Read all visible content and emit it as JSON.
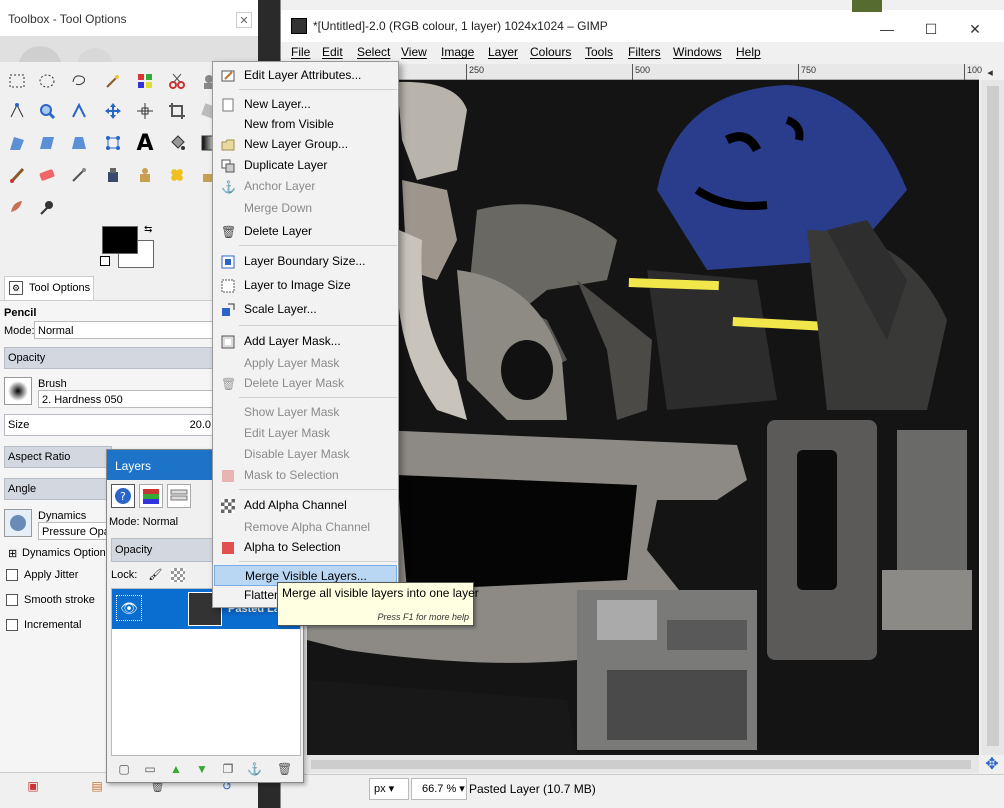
{
  "gimp": {
    "title": "*[Untitled]-2.0 (RGB colour, 1 layer) 1024x1024 – GIMP",
    "menu": [
      "File",
      "Edit",
      "Select",
      "View",
      "Image",
      "Layer",
      "Colours",
      "Tools",
      "Filters",
      "Windows",
      "Help"
    ],
    "ruler_ticks": [
      "250",
      "500",
      "750",
      "100"
    ],
    "minimize_icon": "—",
    "maximize_icon": "☐",
    "close_icon": "✕",
    "status": {
      "unit": "px",
      "zoom": "66.7 %",
      "layer_info": "Pasted Layer (10.7 MB)"
    }
  },
  "toolbox": {
    "title": "Toolbox - Tool Options",
    "tab_label": "Tool Options",
    "tool_name": "Pencil",
    "mode_label": "Mode:",
    "mode_value": "Normal",
    "opacity_label": "Opacity",
    "brush_label": "Brush",
    "brush_value": "2. Hardness 050",
    "size_label": "Size",
    "size_value": "20.0",
    "aspect_label": "Aspect Ratio",
    "angle_label": "Angle",
    "dynamics_label": "Dynamics",
    "dynamics_value": "Pressure Opac",
    "dynamics_options": "Dynamics Options",
    "apply_jitter": "Apply Jitter",
    "smooth_stroke": "Smooth stroke",
    "incremental": "Incremental"
  },
  "layers": {
    "title": "Layers",
    "mode": "Mode: Normal",
    "opacity": "Opacity",
    "lock": "Lock:",
    "layer_name": "Pasted Layer"
  },
  "menu": {
    "items": [
      {
        "label": "Edit Layer Attributes...",
        "disabled": false
      },
      {
        "label": "New Layer...",
        "disabled": false
      },
      {
        "label": "New from Visible",
        "disabled": false
      },
      {
        "label": "New Layer Group...",
        "disabled": false
      },
      {
        "label": "Duplicate Layer",
        "disabled": false
      },
      {
        "label": "Anchor Layer",
        "disabled": true
      },
      {
        "label": "Merge Down",
        "disabled": true
      },
      {
        "label": "Delete Layer",
        "disabled": false
      },
      {
        "label": "Layer Boundary Size...",
        "disabled": false
      },
      {
        "label": "Layer to Image Size",
        "disabled": false
      },
      {
        "label": "Scale Layer...",
        "disabled": false
      },
      {
        "label": "Add Layer Mask...",
        "disabled": false
      },
      {
        "label": "Apply Layer Mask",
        "disabled": true
      },
      {
        "label": "Delete Layer Mask",
        "disabled": true
      },
      {
        "label": "Show Layer Mask",
        "disabled": true
      },
      {
        "label": "Edit Layer Mask",
        "disabled": true
      },
      {
        "label": "Disable Layer Mask",
        "disabled": true
      },
      {
        "label": "Mask to Selection",
        "disabled": true
      },
      {
        "label": "Add Alpha Channel",
        "disabled": false
      },
      {
        "label": "Remove Alpha Channel",
        "disabled": true
      },
      {
        "label": "Alpha to Selection",
        "disabled": false
      },
      {
        "label": "Merge Visible Layers...",
        "disabled": false
      },
      {
        "label": "Flatten Image",
        "disabled": false
      }
    ]
  },
  "tooltip": {
    "text": "Merge all visible layers into one layer",
    "hint": "Press F1 for more help"
  }
}
